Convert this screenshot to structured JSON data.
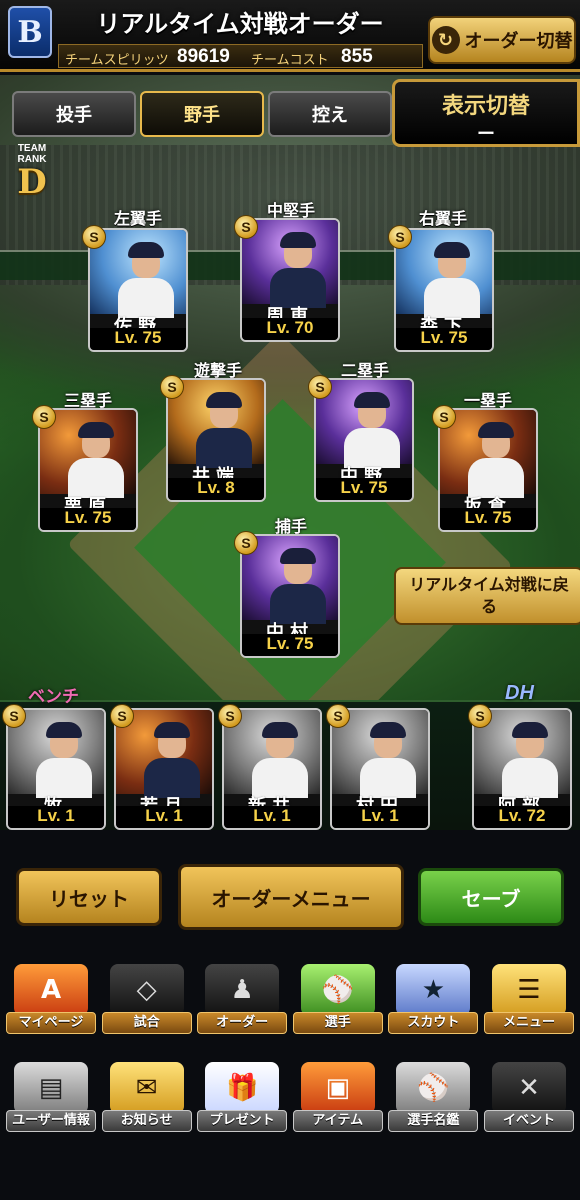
{
  "header": {
    "title": "リアルタイム対戦オーダー",
    "team_logo": "B",
    "team_spirit_label": "チームスピリッツ",
    "team_spirit_value": "89619",
    "team_cost_label": "チームコスト",
    "team_cost_value": "855",
    "order_switch_label": "オーダー切替"
  },
  "tabs": [
    {
      "label": "投手",
      "active": false
    },
    {
      "label": "野手",
      "active": true
    },
    {
      "label": "控え",
      "active": false
    }
  ],
  "display_switch": {
    "label": "表示切替",
    "value": "ー"
  },
  "team_rank": {
    "label": "TEAM RANK",
    "value": "D"
  },
  "lineup": {
    "left_field": {
      "position": "左翼手",
      "name": "佐野",
      "level": "Lv. 75",
      "badge": "S"
    },
    "center_field": {
      "position": "中堅手",
      "name": "周東",
      "level": "Lv. 70",
      "badge": "S"
    },
    "right_field": {
      "position": "右翼手",
      "name": "森下",
      "level": "Lv. 75",
      "badge": "S"
    },
    "shortstop": {
      "position": "遊撃手",
      "name": "井端",
      "level": "Lv. 8",
      "badge": "S"
    },
    "second_base": {
      "position": "二塁手",
      "name": "中野",
      "level": "Lv. 75",
      "badge": "S"
    },
    "third_base": {
      "position": "三塁手",
      "name": "栗原",
      "level": "Lv. 75",
      "badge": "S"
    },
    "first_base": {
      "position": "一塁手",
      "name": "坂倉",
      "level": "Lv. 75",
      "badge": "S"
    },
    "catcher": {
      "position": "捕手",
      "name": "中村",
      "level": "Lv. 75",
      "badge": "S"
    }
  },
  "return_button": "リアルタイム対戦に戻る",
  "bench": {
    "label": "ベンチ",
    "dh_label": "DH",
    "players": [
      {
        "name": "牧",
        "level": "Lv. 1",
        "badge": "S"
      },
      {
        "name": "若月",
        "level": "Lv. 1",
        "badge": "S"
      },
      {
        "name": "新井",
        "level": "Lv. 1",
        "badge": "S"
      },
      {
        "name": "村田",
        "level": "Lv. 1",
        "badge": "S"
      }
    ],
    "dh": {
      "name": "阿部",
      "level": "Lv. 72",
      "badge": "S"
    }
  },
  "actions": {
    "reset": "リセット",
    "order_menu": "オーダーメニュー",
    "save": "セーブ"
  },
  "nav_main": [
    {
      "label": "マイページ",
      "icon": "A"
    },
    {
      "label": "試合",
      "icon": "stadium-icon"
    },
    {
      "label": "オーダー",
      "icon": "order-icon"
    },
    {
      "label": "選手",
      "icon": "player-icon"
    },
    {
      "label": "スカウト",
      "icon": "scout-icon"
    },
    {
      "label": "メニュー",
      "icon": "menu-icon"
    }
  ],
  "nav_sub": [
    {
      "label": "ユーザー情報",
      "icon": "user-card-icon"
    },
    {
      "label": "お知らせ",
      "icon": "notice-icon"
    },
    {
      "label": "プレゼント",
      "icon": "gift-icon"
    },
    {
      "label": "アイテム",
      "icon": "item-icon"
    },
    {
      "label": "選手名鑑",
      "icon": "directory-icon"
    },
    {
      "label": "イベント",
      "icon": "event-icon"
    }
  ]
}
